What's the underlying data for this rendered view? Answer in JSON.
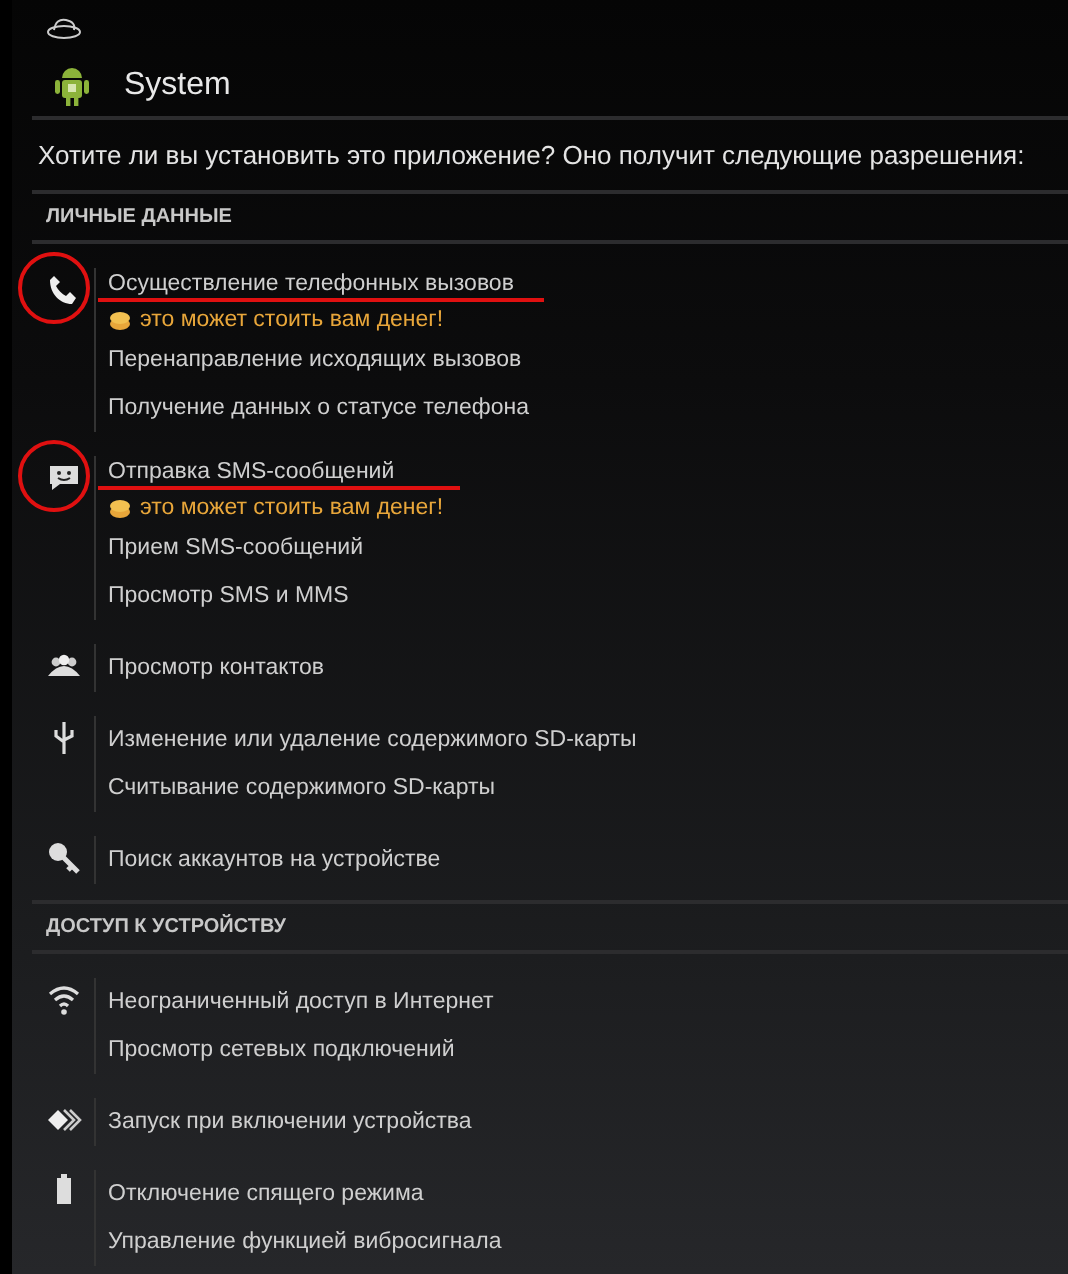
{
  "title": "System",
  "prompt": "Хотите ли вы установить это приложение? Оно получит следующие разрешения:",
  "sections": [
    {
      "header": "ЛИЧНЫЕ ДАННЫЕ",
      "groups": [
        {
          "kind": "phone",
          "circled": true,
          "lines": [
            {
              "kind": "main",
              "text": "Осуществление телефонных вызовов",
              "underlined": true
            },
            {
              "kind": "warning",
              "text": "это может стоить вам денег!"
            },
            {
              "kind": "main",
              "text": "Перенаправление исходящих вызовов",
              "underlined": false
            },
            {
              "kind": "main",
              "text": "Получение данных о статусе телефона",
              "underlined": false
            }
          ]
        },
        {
          "kind": "message",
          "circled": true,
          "lines": [
            {
              "kind": "main",
              "text": "Отправка SMS-сообщений",
              "underlined": true
            },
            {
              "kind": "warning",
              "text": "это может стоить вам денег!"
            },
            {
              "kind": "main",
              "text": "Прием SMS-сообщений",
              "underlined": false
            },
            {
              "kind": "main",
              "text": "Просмотр SMS и MMS",
              "underlined": false
            }
          ]
        },
        {
          "kind": "people",
          "circled": false,
          "lines": [
            {
              "kind": "main",
              "text": "Просмотр контактов",
              "underlined": false
            }
          ]
        },
        {
          "kind": "usb",
          "circled": false,
          "lines": [
            {
              "kind": "main",
              "text": "Изменение или удаление содержимого SD-карты",
              "underlined": false
            },
            {
              "kind": "main",
              "text": "Считывание содержимого SD-карты",
              "underlined": false
            }
          ]
        },
        {
          "kind": "key",
          "circled": false,
          "lines": [
            {
              "kind": "main",
              "text": "Поиск аккаунтов на устройстве",
              "underlined": false
            }
          ]
        }
      ]
    },
    {
      "header": "ДОСТУП К УСТРОЙСТВУ",
      "groups": [
        {
          "kind": "wifi",
          "circled": false,
          "lines": [
            {
              "kind": "main",
              "text": "Неограниченный доступ в Интернет",
              "underlined": false
            },
            {
              "kind": "main",
              "text": "Просмотр сетевых подключений",
              "underlined": false
            }
          ]
        },
        {
          "kind": "arrows",
          "circled": false,
          "lines": [
            {
              "kind": "main",
              "text": "Запуск при включении устройства",
              "underlined": false
            }
          ]
        },
        {
          "kind": "battery",
          "circled": false,
          "lines": [
            {
              "kind": "main",
              "text": "Отключение спящего режима",
              "underlined": false
            },
            {
              "kind": "main",
              "text": "Управление функцией вибросигнала",
              "underlined": false
            }
          ]
        }
      ]
    }
  ]
}
